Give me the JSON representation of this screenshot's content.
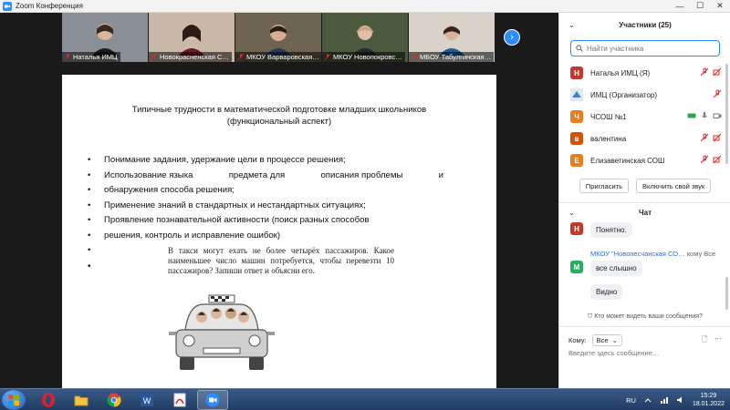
{
  "window": {
    "title": "Zoom Конференция"
  },
  "thumbnails": [
    {
      "label": "Наталья ИМЦ",
      "bg": "#8a8f96",
      "shirt": "#1d1d1d"
    },
    {
      "label": "Новокрасненская С…",
      "bg": "#c9b8a8",
      "shirt": "#6b1c2a"
    },
    {
      "label": "МКОУ Варваровская…",
      "bg": "#6d6451",
      "shirt": "#2c3a5c"
    },
    {
      "label": "МКОУ Новопокровс…",
      "bg": "#4b5a3f",
      "shirt": "#2a2a2a"
    },
    {
      "label": "МБОУ Табулгинская…",
      "bg": "#d8d2c8",
      "shirt": "#1b5e9a"
    }
  ],
  "slide": {
    "title_line1": "Типичные трудности в математической подготовке младших школьников",
    "title_line2": "(функциональный аспект)",
    "bullets": {
      "b1": "Понимание задания, удержание цели в процессе решения;",
      "b2_w1": "Использование языка",
      "b2_w2": "предмета для",
      "b2_w3": "описания проблемы",
      "b2_w4": "и",
      "b3": "обнаружения способа решения;",
      "b4": "Применение знаний в стандартных и нестандартных ситуациях;",
      "b5": "Проявление познавательной активности (поиск разных способов",
      "b6": "решения, контроль и исправление ошибок)"
    },
    "problem_text": "В такси могут ехать не более четырёх пассажиров. Какое наименьшее число машин потребуется, чтобы перевезти 10 пассажиров? Запиши ответ и объясни его."
  },
  "participants": {
    "header": "Участники (25)",
    "search_placeholder": "Найти участника",
    "list": [
      {
        "initial": "Н",
        "name": "Наталья ИМЦ (Я)",
        "color": "#c0392b"
      },
      {
        "initial": "",
        "name": "ИМЦ (Организатор)",
        "color": "#4a7fbf"
      },
      {
        "initial": "Ч",
        "name": "ЧСОШ №1",
        "color": "#e67e22"
      },
      {
        "initial": "в",
        "name": "валентина",
        "color": "#d35400"
      },
      {
        "initial": "Е",
        "name": "Елизаветинская СОШ",
        "color": "#e67e22"
      }
    ],
    "invite": "Пригласить",
    "unmute": "Включить свой звук"
  },
  "chat": {
    "header": "Чат",
    "msg1": "Понятно.",
    "msg1_initial": "Н",
    "sender2": "МКОУ \"Новопесчанская СО…",
    "sender2_to": "кому Все",
    "msg2_initial": "М",
    "msg2a": "все слышно",
    "msg2b": "Видно",
    "who_sees": "Кто может видеть ваши сообщения?",
    "to_label": "Кому:",
    "to_value": "Все",
    "input_placeholder": "Введите здесь сообщение…"
  },
  "taskbar": {
    "lang": "RU",
    "time": "15:29",
    "date": "18.01.2022"
  },
  "colors": {
    "zoom_blue": "#2d8cff",
    "muted_red": "#e02828"
  }
}
